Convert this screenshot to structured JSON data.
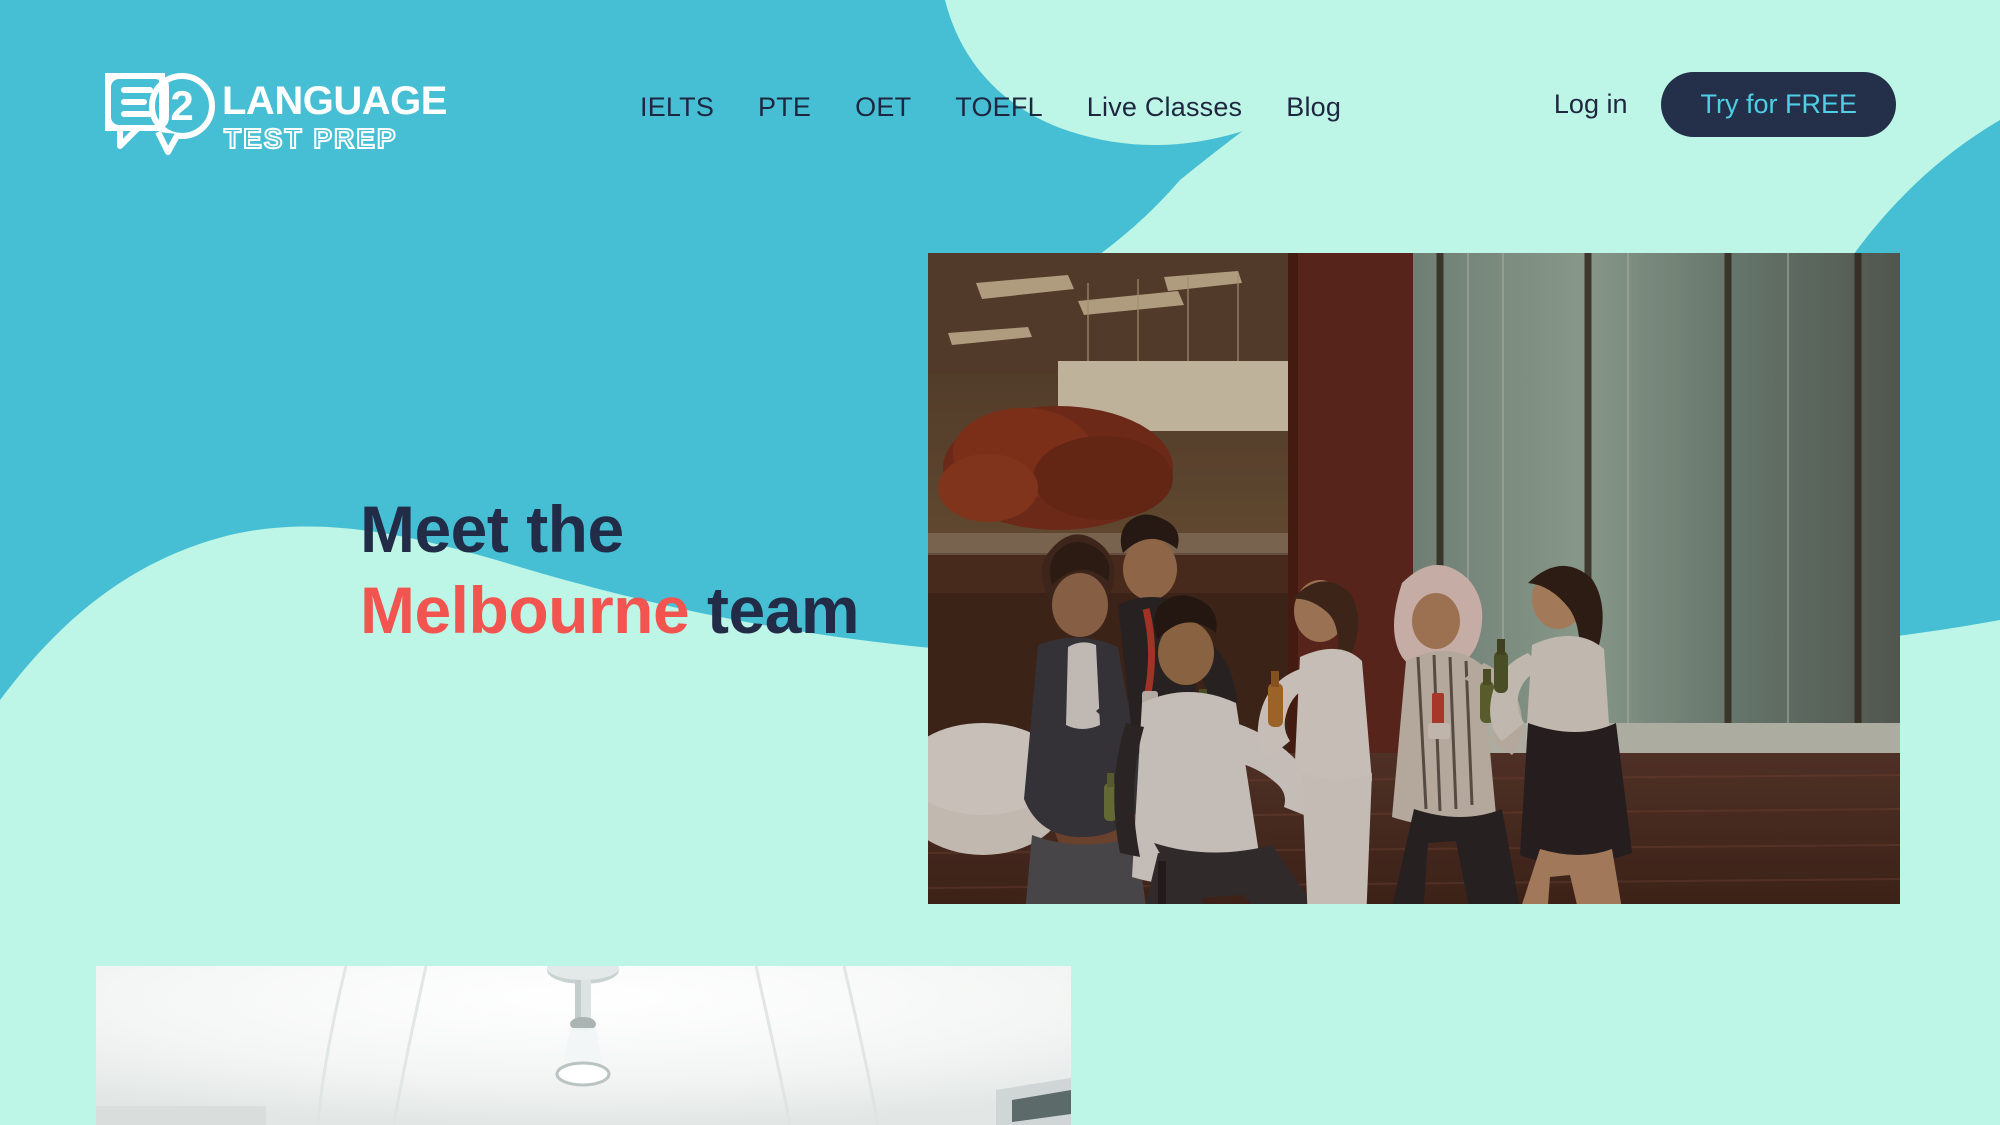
{
  "site": {
    "logo": {
      "mark": "E2",
      "name": "LANGUAGE",
      "tagline": "TEST PREP",
      "icon": "e2-speech-bubble-logo-icon"
    }
  },
  "header": {
    "nav": [
      {
        "label": "IELTS"
      },
      {
        "label": "PTE"
      },
      {
        "label": "OET"
      },
      {
        "label": "TOEFL"
      },
      {
        "label": "Live Classes"
      },
      {
        "label": "Blog"
      }
    ],
    "login_label": "Log in",
    "cta_label": "Try for FREE"
  },
  "hero": {
    "heading_line1": "Meet the",
    "heading_line2_accent": "Melbourne",
    "heading_line2_rest": " team",
    "team_photo_alt": "E2 Melbourne team celebrating in the office",
    "ceiling_photo_alt": "White office ceiling with pendant light"
  },
  "colors": {
    "teal_background": "#46bfd5",
    "mint_shape": "#bdf5e6",
    "navy_text": "#222c47",
    "coral_accent": "#f2544f",
    "cta_background": "#24304a",
    "cta_text": "#4ecfe5"
  }
}
